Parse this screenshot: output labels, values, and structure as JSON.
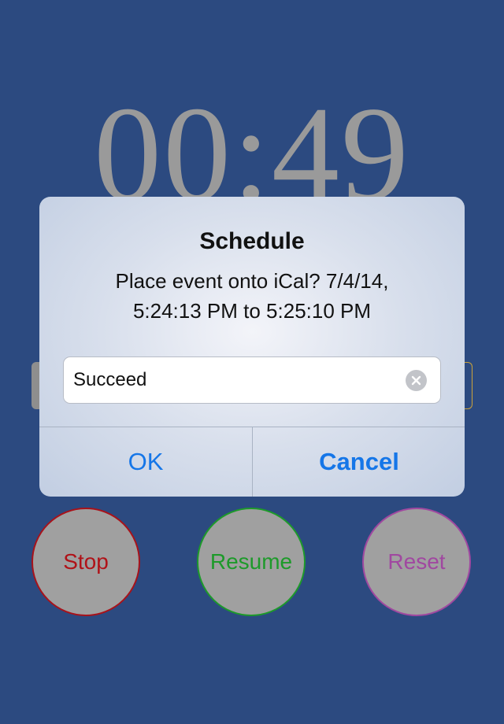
{
  "timer": {
    "display": "00:49"
  },
  "controls": {
    "stop_label": "Stop",
    "resume_label": "Resume",
    "reset_label": "Reset"
  },
  "dialog": {
    "title": "Schedule",
    "message_line1": "Place event onto iCal? 7/4/14,",
    "message_line2": "5:24:13 PM to 5:25:10 PM",
    "input_value": "Succeed",
    "ok_label": "OK",
    "cancel_label": "Cancel"
  },
  "icons": {
    "clear": "clear-text-icon"
  },
  "colors": {
    "background": "#2c4a80",
    "timer_text": "#9a9a9a",
    "stop": "#b01218",
    "resume": "#1d9a2a",
    "reset": "#a048a0",
    "dialog_button": "#1576e8"
  }
}
